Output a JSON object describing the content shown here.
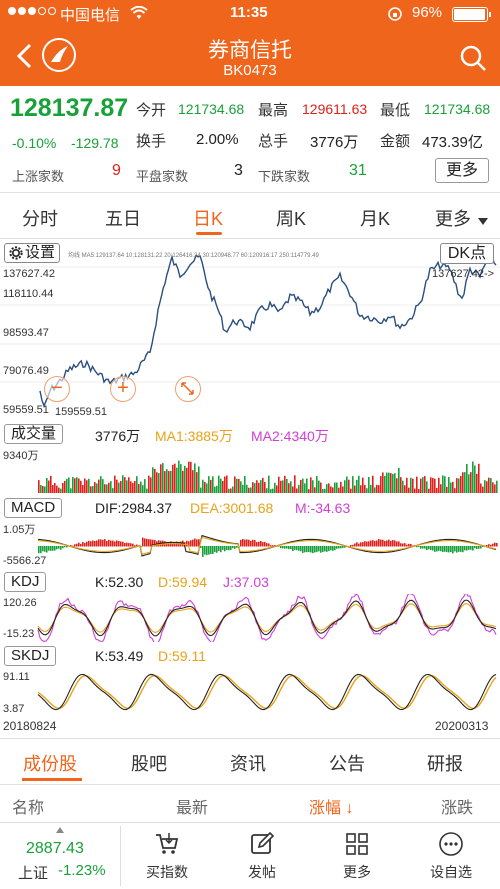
{
  "status_bar": {
    "carrier": "中国电信",
    "time": "11:35",
    "battery": "96%",
    "battery_level": 0.96
  },
  "header": {
    "title": "券商信托",
    "code": "BK0473"
  },
  "quote": {
    "price": "128137.87",
    "change_pct": "-0.10%",
    "change": "-129.78",
    "open_label": "今开",
    "open": "121734.68",
    "high_label": "最高",
    "high": "129611.63",
    "low_label": "最低",
    "low": "121734.68",
    "turnover_label": "换手",
    "turnover": "2.00%",
    "volume_label": "总手",
    "volume": "3776万",
    "amount_label": "金额",
    "amount": "473.39亿",
    "up_label": "上涨家数",
    "up": "9",
    "flat_label": "平盘家数",
    "flat": "3",
    "down_label": "下跌家数",
    "down": "31",
    "more_label": "更多"
  },
  "tabs": [
    "分时",
    "五日",
    "日K",
    "周K",
    "月K",
    "更多"
  ],
  "chart": {
    "settings_label": "设置",
    "dk_label": "DK点",
    "ma_legend": "均线 MA5:129137.64  10:128131.22  20:126416.34  30:120948.77  60:120916.17  250:114779.49",
    "price_max": "137627.42",
    "price_max_right": "137627.42->",
    "price_mid1": "118110.44",
    "price_mid2": "98593.47",
    "price_mid3": "79076.49",
    "price_min": "59559.51",
    "price_min_right": "159559.51",
    "volume_label": "成交量",
    "volume_val": "3776万",
    "ma1": "MA1:3885万",
    "ma2": "MA2:4340万",
    "volume_max": "9340万",
    "macd_label": "MACD",
    "dif": "DIF:2984.37",
    "dea": "DEA:3001.68",
    "m": "M:-34.63",
    "macd_top": "1.05万",
    "macd_bottom": "-5566.27",
    "kdj_label": "KDJ",
    "k": "K:52.30",
    "d": "D:59.94",
    "j": "J:37.03",
    "kdj_top": "120.26",
    "kdj_bottom": "-15.23",
    "skdj_label": "SKDJ",
    "sk": "K:53.49",
    "sd": "D:59.11",
    "skdj_top": "91.11",
    "skdj_bottom": "3.87",
    "date_start": "20180824",
    "date_end": "20200313"
  },
  "bottom_tabs": [
    "成份股",
    "股吧",
    "资讯",
    "公告",
    "研报"
  ],
  "columns": {
    "name": "名称",
    "latest": "最新",
    "change_pct": "涨幅 ↓",
    "change": "涨跌"
  },
  "footer": {
    "index_value": "2887.43",
    "index_name": "上证",
    "index_change": "-1.23%",
    "items": [
      "买指数",
      "发帖",
      "更多",
      "设自选"
    ]
  },
  "colors": {
    "accent": "#f0651c",
    "up": "#e0201a",
    "down": "#18a138"
  }
}
